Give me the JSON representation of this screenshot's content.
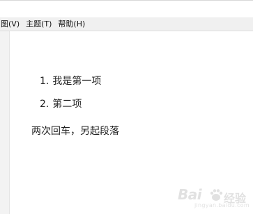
{
  "menubar": {
    "items": [
      {
        "label": "图(V)"
      },
      {
        "label": "主题(T)"
      },
      {
        "label": "帮助(H)"
      }
    ]
  },
  "editor": {
    "ordered_list": [
      {
        "number": "1.",
        "text": "我是第一项"
      },
      {
        "number": "2.",
        "text": "第二项"
      }
    ],
    "paragraph": "两次回车，另起段落"
  },
  "watermark": {
    "brand": "Bai",
    "sub": "经验",
    "url": "jingyan.baidu.com",
    "color": "#c9c9c9"
  }
}
